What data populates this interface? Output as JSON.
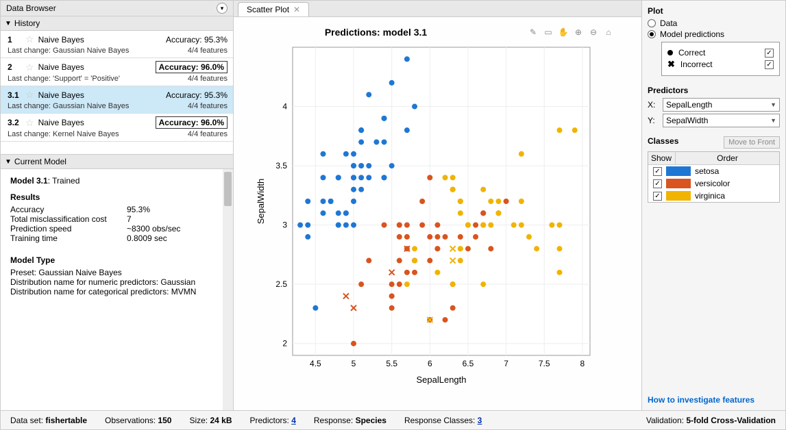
{
  "dataBrowserTitle": "Data Browser",
  "historyHeader": "History",
  "history": [
    {
      "idx": "1",
      "name": "Naive Bayes",
      "acc": "Accuracy:  95.3%",
      "boxed": false,
      "lc": "Last change:  Gaussian Naive Bayes",
      "feat": "4/4 features",
      "sel": false
    },
    {
      "idx": "2",
      "name": "Naive Bayes",
      "acc": "Accuracy:  96.0%",
      "boxed": true,
      "lc": "Last change:  'Support' = 'Positive'",
      "feat": "4/4 features",
      "sel": false
    },
    {
      "idx": "3.1",
      "name": "Naive Bayes",
      "acc": "Accuracy:  95.3%",
      "boxed": false,
      "lc": "Last change:  Gaussian Naive Bayes",
      "feat": "4/4 features",
      "sel": true
    },
    {
      "idx": "3.2",
      "name": "Naive Bayes",
      "acc": "Accuracy:  96.0%",
      "boxed": true,
      "lc": "Last change:  Kernel Naive Bayes",
      "feat": "4/4 features",
      "sel": false
    }
  ],
  "currentModelHeader": "Current Model",
  "cm": {
    "title_a": "Model 3.1",
    "title_b": ": Trained",
    "resultsH": "Results",
    "rows": [
      {
        "k": "Accuracy",
        "v": "95.3%"
      },
      {
        "k": "Total misclassification cost",
        "v": "7"
      },
      {
        "k": "Prediction speed",
        "v": "~8300 obs/sec"
      },
      {
        "k": "Training time",
        "v": "0.8009 sec"
      }
    ],
    "typeH": "Model Type",
    "typeLines": [
      "Preset: Gaussian Naive Bayes",
      "Distribution name for numeric predictors: Gaussian",
      "Distribution name for categorical predictors: MVMN"
    ]
  },
  "tabLabel": "Scatter Plot",
  "chart_data": {
    "type": "scatter",
    "title": "Predictions: model 3.1",
    "xlabel": "SepalLength",
    "ylabel": "SepalWidth",
    "xlim": [
      4.2,
      8.1
    ],
    "ylim": [
      1.9,
      4.5
    ],
    "xticks": [
      4.5,
      5,
      5.5,
      6,
      6.5,
      7,
      7.5,
      8
    ],
    "yticks": [
      2,
      2.5,
      3,
      3.5,
      4
    ],
    "colors": {
      "setosa": "#1f77d4",
      "versicolor": "#d9541e",
      "virginica": "#f0b400"
    },
    "series": [
      {
        "name": "setosa",
        "marker": "circle",
        "points": [
          [
            5.1,
            3.5
          ],
          [
            4.9,
            3.0
          ],
          [
            4.7,
            3.2
          ],
          [
            4.6,
            3.1
          ],
          [
            5.0,
            3.6
          ],
          [
            5.4,
            3.9
          ],
          [
            4.6,
            3.4
          ],
          [
            5.0,
            3.4
          ],
          [
            4.4,
            2.9
          ],
          [
            4.9,
            3.1
          ],
          [
            5.4,
            3.7
          ],
          [
            4.8,
            3.4
          ],
          [
            4.8,
            3.0
          ],
          [
            4.3,
            3.0
          ],
          [
            5.8,
            4.0
          ],
          [
            5.7,
            4.4
          ],
          [
            5.4,
            3.9
          ],
          [
            5.1,
            3.5
          ],
          [
            5.7,
            3.8
          ],
          [
            5.1,
            3.8
          ],
          [
            5.4,
            3.4
          ],
          [
            5.1,
            3.7
          ],
          [
            4.6,
            3.6
          ],
          [
            5.1,
            3.3
          ],
          [
            4.8,
            3.4
          ],
          [
            5.0,
            3.0
          ],
          [
            5.0,
            3.4
          ],
          [
            5.2,
            3.5
          ],
          [
            5.2,
            3.4
          ],
          [
            4.7,
            3.2
          ],
          [
            4.8,
            3.1
          ],
          [
            5.4,
            3.4
          ],
          [
            5.2,
            4.1
          ],
          [
            5.5,
            4.2
          ],
          [
            4.9,
            3.1
          ],
          [
            5.0,
            3.2
          ],
          [
            5.5,
            3.5
          ],
          [
            4.9,
            3.6
          ],
          [
            4.4,
            3.0
          ],
          [
            5.1,
            3.4
          ],
          [
            5.0,
            3.5
          ],
          [
            4.5,
            2.3
          ],
          [
            4.4,
            3.2
          ],
          [
            5.0,
            3.5
          ],
          [
            5.1,
            3.8
          ],
          [
            4.8,
            3.0
          ],
          [
            5.1,
            3.8
          ],
          [
            4.6,
            3.2
          ],
          [
            5.3,
            3.7
          ],
          [
            5.0,
            3.3
          ]
        ]
      },
      {
        "name": "versicolor",
        "marker": "circle",
        "points": [
          [
            7.0,
            3.2
          ],
          [
            6.4,
            3.2
          ],
          [
            6.9,
            3.1
          ],
          [
            5.5,
            2.3
          ],
          [
            6.5,
            2.8
          ],
          [
            5.7,
            2.8
          ],
          [
            6.3,
            3.3
          ],
          [
            6.6,
            2.9
          ],
          [
            5.2,
            2.7
          ],
          [
            5.0,
            2.0
          ],
          [
            5.9,
            3.0
          ],
          [
            6.0,
            2.2
          ],
          [
            6.1,
            2.9
          ],
          [
            5.6,
            2.9
          ],
          [
            6.7,
            3.1
          ],
          [
            5.6,
            3.0
          ],
          [
            5.8,
            2.7
          ],
          [
            6.2,
            2.2
          ],
          [
            5.6,
            2.5
          ],
          [
            5.9,
            3.2
          ],
          [
            6.1,
            2.8
          ],
          [
            6.3,
            2.5
          ],
          [
            6.1,
            2.8
          ],
          [
            6.4,
            2.9
          ],
          [
            6.6,
            3.0
          ],
          [
            6.8,
            2.8
          ],
          [
            6.7,
            3.0
          ],
          [
            6.0,
            2.9
          ],
          [
            5.7,
            2.6
          ],
          [
            5.5,
            2.4
          ],
          [
            5.5,
            2.4
          ],
          [
            5.8,
            2.7
          ],
          [
            6.0,
            2.7
          ],
          [
            5.4,
            3.0
          ],
          [
            6.0,
            3.4
          ],
          [
            6.7,
            3.1
          ],
          [
            6.3,
            2.3
          ],
          [
            5.6,
            3.0
          ],
          [
            5.5,
            2.5
          ],
          [
            6.1,
            3.0
          ],
          [
            5.8,
            2.6
          ],
          [
            5.6,
            2.7
          ],
          [
            5.7,
            3.0
          ],
          [
            5.7,
            2.9
          ],
          [
            6.2,
            2.9
          ],
          [
            5.1,
            2.5
          ]
        ]
      },
      {
        "name": "virginica",
        "marker": "circle",
        "points": [
          [
            6.3,
            3.3
          ],
          [
            5.8,
            2.7
          ],
          [
            7.1,
            3.0
          ],
          [
            6.5,
            3.0
          ],
          [
            7.6,
            3.0
          ],
          [
            7.3,
            2.9
          ],
          [
            6.7,
            2.5
          ],
          [
            7.2,
            3.6
          ],
          [
            6.4,
            2.7
          ],
          [
            6.8,
            3.0
          ],
          [
            5.7,
            2.5
          ],
          [
            5.8,
            2.8
          ],
          [
            6.4,
            3.2
          ],
          [
            6.5,
            3.0
          ],
          [
            7.7,
            3.8
          ],
          [
            7.7,
            2.6
          ],
          [
            6.9,
            3.2
          ],
          [
            7.7,
            2.8
          ],
          [
            6.7,
            3.3
          ],
          [
            7.2,
            3.2
          ],
          [
            6.4,
            2.8
          ],
          [
            7.2,
            3.0
          ],
          [
            7.4,
            2.8
          ],
          [
            7.9,
            3.8
          ],
          [
            6.4,
            2.8
          ],
          [
            6.1,
            2.6
          ],
          [
            7.7,
            3.0
          ],
          [
            6.3,
            3.4
          ],
          [
            6.4,
            3.1
          ],
          [
            6.9,
            3.1
          ],
          [
            6.9,
            3.1
          ],
          [
            6.8,
            3.2
          ],
          [
            6.7,
            3.0
          ],
          [
            6.3,
            2.5
          ],
          [
            6.5,
            3.0
          ],
          [
            6.2,
            3.4
          ]
        ]
      },
      {
        "name": "versicolor-incorrect",
        "marker": "x",
        "points": [
          [
            4.9,
            2.4
          ],
          [
            5.5,
            2.6
          ],
          [
            5.0,
            2.3
          ],
          [
            5.7,
            2.8
          ]
        ]
      },
      {
        "name": "virginica-incorrect",
        "marker": "x",
        "points": [
          [
            6.3,
            2.8
          ],
          [
            6.0,
            2.2
          ],
          [
            6.3,
            2.7
          ]
        ]
      }
    ]
  },
  "plot": {
    "sectionTitle": "Plot",
    "radioData": "Data",
    "radioModel": "Model predictions",
    "legendCorrect": "Correct",
    "legendIncorrect": "Incorrect"
  },
  "predictors": {
    "title": "Predictors",
    "x": "SepalLength",
    "y": "SepalWidth"
  },
  "classes": {
    "title": "Classes",
    "btn": "Move to Front",
    "showH": "Show",
    "orderH": "Order",
    "rows": [
      {
        "name": "setosa",
        "color": "#1f77d4"
      },
      {
        "name": "versicolor",
        "color": "#d9541e"
      },
      {
        "name": "virginica",
        "color": "#f0b400"
      }
    ]
  },
  "howTo": "How to investigate features",
  "status": {
    "ds_k": "Data set: ",
    "ds_v": "fishertable",
    "obs_k": "Observations: ",
    "obs_v": "150",
    "sz_k": "Size: ",
    "sz_v": "24 kB",
    "pr_k": "Predictors: ",
    "pr_v": "4",
    "rs_k": "Response: ",
    "rs_v": "Species",
    "rc_k": "Response Classes: ",
    "rc_v": "3",
    "val_k": "Validation: ",
    "val_v": "5-fold Cross-Validation"
  }
}
